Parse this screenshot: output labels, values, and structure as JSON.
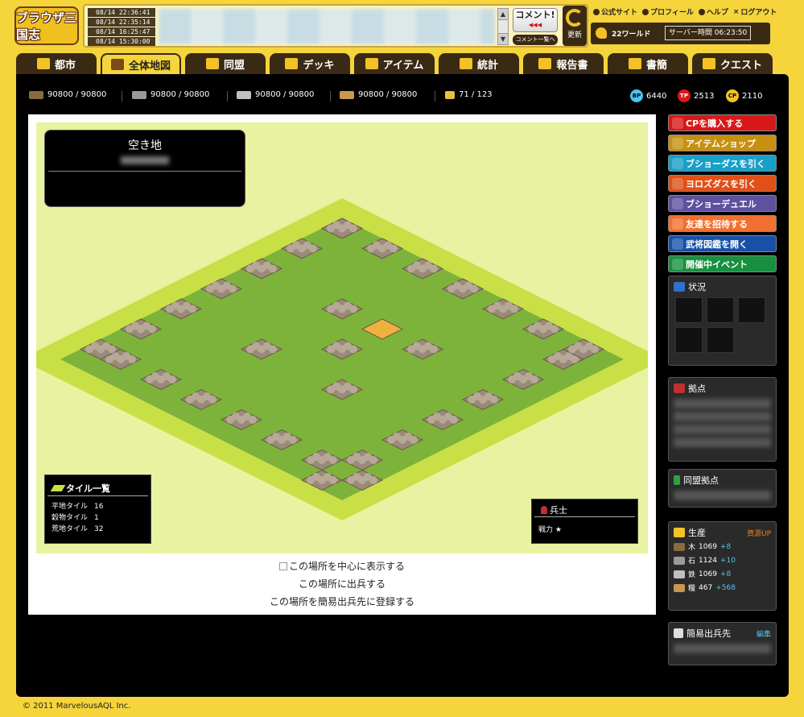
{
  "header": {
    "logo_text": "ブラウザ三国志",
    "timestamps": [
      "08/14 22:36:41",
      "08/14 22:35:14",
      "08/14 16:25:47",
      "08/14 15:30:00"
    ],
    "comment_button": "コメント!",
    "comment_button_arrows": "◀◀◀",
    "comment_list_button": "コメント一覧へ",
    "refresh_button": "更新",
    "links": [
      "公式サイト",
      "プロフィール",
      "ヘルプ",
      "ログアウト"
    ],
    "world_name": "22ワールド",
    "server_time": "サーバー時間 06:23:50"
  },
  "nav": {
    "tabs": [
      {
        "label": "都市",
        "dropdown": false,
        "active": false
      },
      {
        "label": "全体地図",
        "dropdown": false,
        "active": true
      },
      {
        "label": "同盟",
        "dropdown": true,
        "active": false
      },
      {
        "label": "デッキ",
        "dropdown": true,
        "active": false
      },
      {
        "label": "アイテム",
        "dropdown": true,
        "active": false
      },
      {
        "label": "統計",
        "dropdown": false,
        "active": false
      },
      {
        "label": "報告書",
        "dropdown": true,
        "active": false
      },
      {
        "label": "書簡",
        "dropdown": true,
        "active": false
      },
      {
        "label": "クエスト",
        "dropdown": false,
        "active": false
      }
    ],
    "dropdown_glyph": "▼"
  },
  "resources": {
    "wood": "90800 / 90800",
    "stone": "90800 / 90800",
    "iron": "90800 / 90800",
    "grain": "90800 / 90800",
    "population": "71 / 123",
    "bp_label": "BP",
    "bp": "6440",
    "tp_label": "TP",
    "tp": "2513",
    "cp_label": "CP",
    "cp": "2110"
  },
  "map_info": {
    "title": "空き地"
  },
  "tile_list": {
    "title": "タイル一覧",
    "rows": [
      {
        "label": "平地タイル",
        "value": "16"
      },
      {
        "label": "穀物タイル",
        "value": "1"
      },
      {
        "label": "荒地タイル",
        "value": "32"
      }
    ]
  },
  "troops": {
    "title": "兵士",
    "power_label": "戦力",
    "power_value": "★"
  },
  "actions": {
    "center": "この場所を中心に表示する",
    "dispatch": "この場所に出兵する",
    "register": "この場所を簡易出兵先に登録する"
  },
  "side_buttons": [
    {
      "label": "CPを購入する",
      "color": "#d81818"
    },
    {
      "label": "アイテムショップ",
      "color": "#c89010"
    },
    {
      "label": "ブショーダスを引く",
      "color": "#18a0c8"
    },
    {
      "label": "ヨロズダスを引く",
      "color": "#e05018"
    },
    {
      "label": "ブショーデュエル",
      "color": "#6050a0"
    },
    {
      "label": "友達を招待する",
      "color": "#f07030"
    },
    {
      "label": "武将図鑑を開く",
      "color": "#1850a8"
    },
    {
      "label": "開催中イベント",
      "color": "#189040"
    }
  ],
  "side_panels": {
    "status_title": "状況",
    "bases_title": "拠点",
    "alliance_bases_title": "同盟拠点",
    "production_title": "生産",
    "resource_up_link": "資源UP",
    "production": [
      {
        "name": "木",
        "value": "1069",
        "plus": "+8"
      },
      {
        "name": "石",
        "value": "1124",
        "plus": "+10"
      },
      {
        "name": "鉄",
        "value": "1069",
        "plus": "+8"
      },
      {
        "name": "糧",
        "value": "467",
        "plus": "+568"
      }
    ],
    "quick_dispatch_title": "簡易出兵先",
    "edit_link": "編集"
  },
  "footer": {
    "copyright": "© 2011 MarvelousAQL Inc."
  },
  "colors": {
    "background": "#f5d43c",
    "frame": "#000000",
    "grass": "#7db33a",
    "border_grass": "#c8e046",
    "rocks": "#9a8a7a",
    "grain_tile": "#f0b040"
  }
}
